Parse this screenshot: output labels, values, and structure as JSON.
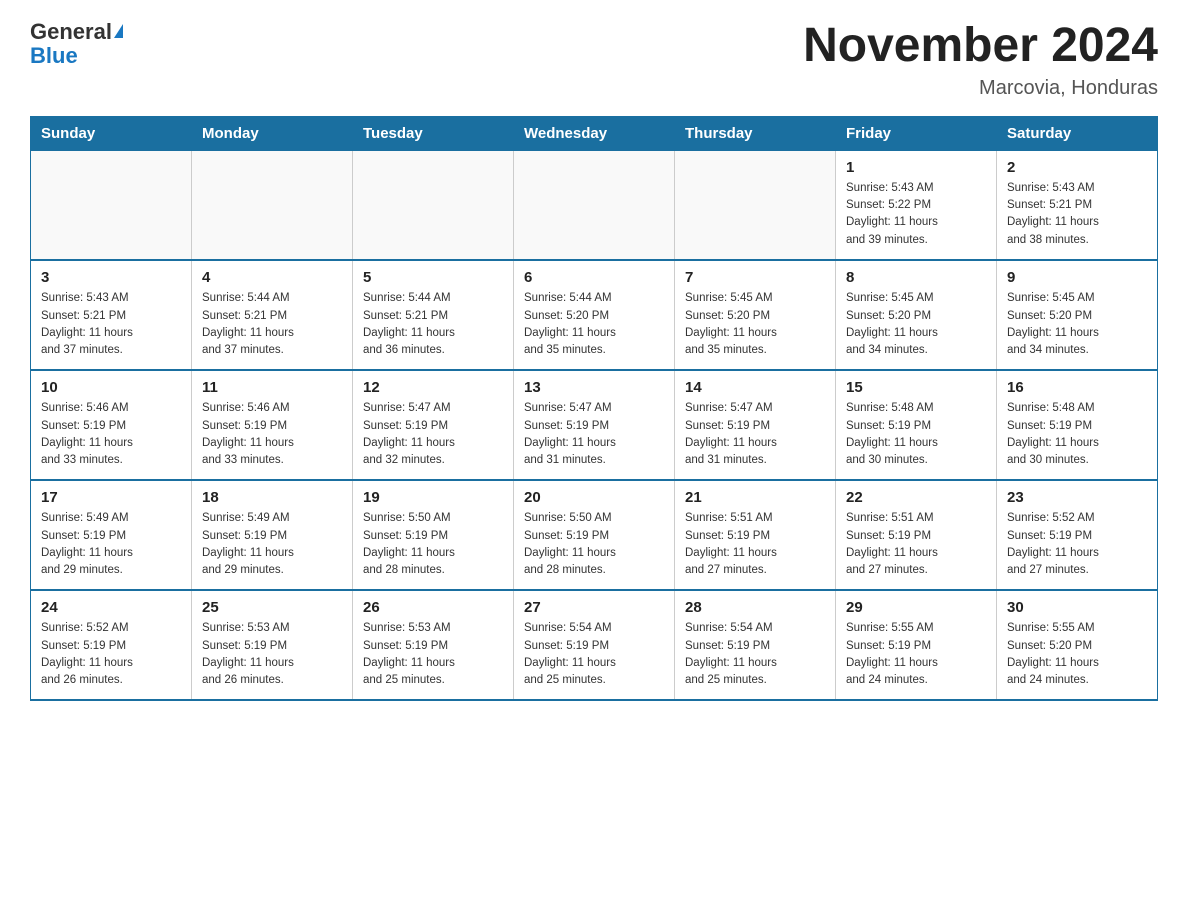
{
  "header": {
    "logo_general": "General",
    "logo_blue": "Blue",
    "month_title": "November 2024",
    "location": "Marcovia, Honduras"
  },
  "weekdays": [
    "Sunday",
    "Monday",
    "Tuesday",
    "Wednesday",
    "Thursday",
    "Friday",
    "Saturday"
  ],
  "rows": [
    [
      {
        "day": "",
        "info": ""
      },
      {
        "day": "",
        "info": ""
      },
      {
        "day": "",
        "info": ""
      },
      {
        "day": "",
        "info": ""
      },
      {
        "day": "",
        "info": ""
      },
      {
        "day": "1",
        "info": "Sunrise: 5:43 AM\nSunset: 5:22 PM\nDaylight: 11 hours\nand 39 minutes."
      },
      {
        "day": "2",
        "info": "Sunrise: 5:43 AM\nSunset: 5:21 PM\nDaylight: 11 hours\nand 38 minutes."
      }
    ],
    [
      {
        "day": "3",
        "info": "Sunrise: 5:43 AM\nSunset: 5:21 PM\nDaylight: 11 hours\nand 37 minutes."
      },
      {
        "day": "4",
        "info": "Sunrise: 5:44 AM\nSunset: 5:21 PM\nDaylight: 11 hours\nand 37 minutes."
      },
      {
        "day": "5",
        "info": "Sunrise: 5:44 AM\nSunset: 5:21 PM\nDaylight: 11 hours\nand 36 minutes."
      },
      {
        "day": "6",
        "info": "Sunrise: 5:44 AM\nSunset: 5:20 PM\nDaylight: 11 hours\nand 35 minutes."
      },
      {
        "day": "7",
        "info": "Sunrise: 5:45 AM\nSunset: 5:20 PM\nDaylight: 11 hours\nand 35 minutes."
      },
      {
        "day": "8",
        "info": "Sunrise: 5:45 AM\nSunset: 5:20 PM\nDaylight: 11 hours\nand 34 minutes."
      },
      {
        "day": "9",
        "info": "Sunrise: 5:45 AM\nSunset: 5:20 PM\nDaylight: 11 hours\nand 34 minutes."
      }
    ],
    [
      {
        "day": "10",
        "info": "Sunrise: 5:46 AM\nSunset: 5:19 PM\nDaylight: 11 hours\nand 33 minutes."
      },
      {
        "day": "11",
        "info": "Sunrise: 5:46 AM\nSunset: 5:19 PM\nDaylight: 11 hours\nand 33 minutes."
      },
      {
        "day": "12",
        "info": "Sunrise: 5:47 AM\nSunset: 5:19 PM\nDaylight: 11 hours\nand 32 minutes."
      },
      {
        "day": "13",
        "info": "Sunrise: 5:47 AM\nSunset: 5:19 PM\nDaylight: 11 hours\nand 31 minutes."
      },
      {
        "day": "14",
        "info": "Sunrise: 5:47 AM\nSunset: 5:19 PM\nDaylight: 11 hours\nand 31 minutes."
      },
      {
        "day": "15",
        "info": "Sunrise: 5:48 AM\nSunset: 5:19 PM\nDaylight: 11 hours\nand 30 minutes."
      },
      {
        "day": "16",
        "info": "Sunrise: 5:48 AM\nSunset: 5:19 PM\nDaylight: 11 hours\nand 30 minutes."
      }
    ],
    [
      {
        "day": "17",
        "info": "Sunrise: 5:49 AM\nSunset: 5:19 PM\nDaylight: 11 hours\nand 29 minutes."
      },
      {
        "day": "18",
        "info": "Sunrise: 5:49 AM\nSunset: 5:19 PM\nDaylight: 11 hours\nand 29 minutes."
      },
      {
        "day": "19",
        "info": "Sunrise: 5:50 AM\nSunset: 5:19 PM\nDaylight: 11 hours\nand 28 minutes."
      },
      {
        "day": "20",
        "info": "Sunrise: 5:50 AM\nSunset: 5:19 PM\nDaylight: 11 hours\nand 28 minutes."
      },
      {
        "day": "21",
        "info": "Sunrise: 5:51 AM\nSunset: 5:19 PM\nDaylight: 11 hours\nand 27 minutes."
      },
      {
        "day": "22",
        "info": "Sunrise: 5:51 AM\nSunset: 5:19 PM\nDaylight: 11 hours\nand 27 minutes."
      },
      {
        "day": "23",
        "info": "Sunrise: 5:52 AM\nSunset: 5:19 PM\nDaylight: 11 hours\nand 27 minutes."
      }
    ],
    [
      {
        "day": "24",
        "info": "Sunrise: 5:52 AM\nSunset: 5:19 PM\nDaylight: 11 hours\nand 26 minutes."
      },
      {
        "day": "25",
        "info": "Sunrise: 5:53 AM\nSunset: 5:19 PM\nDaylight: 11 hours\nand 26 minutes."
      },
      {
        "day": "26",
        "info": "Sunrise: 5:53 AM\nSunset: 5:19 PM\nDaylight: 11 hours\nand 25 minutes."
      },
      {
        "day": "27",
        "info": "Sunrise: 5:54 AM\nSunset: 5:19 PM\nDaylight: 11 hours\nand 25 minutes."
      },
      {
        "day": "28",
        "info": "Sunrise: 5:54 AM\nSunset: 5:19 PM\nDaylight: 11 hours\nand 25 minutes."
      },
      {
        "day": "29",
        "info": "Sunrise: 5:55 AM\nSunset: 5:19 PM\nDaylight: 11 hours\nand 24 minutes."
      },
      {
        "day": "30",
        "info": "Sunrise: 5:55 AM\nSunset: 5:20 PM\nDaylight: 11 hours\nand 24 minutes."
      }
    ]
  ]
}
